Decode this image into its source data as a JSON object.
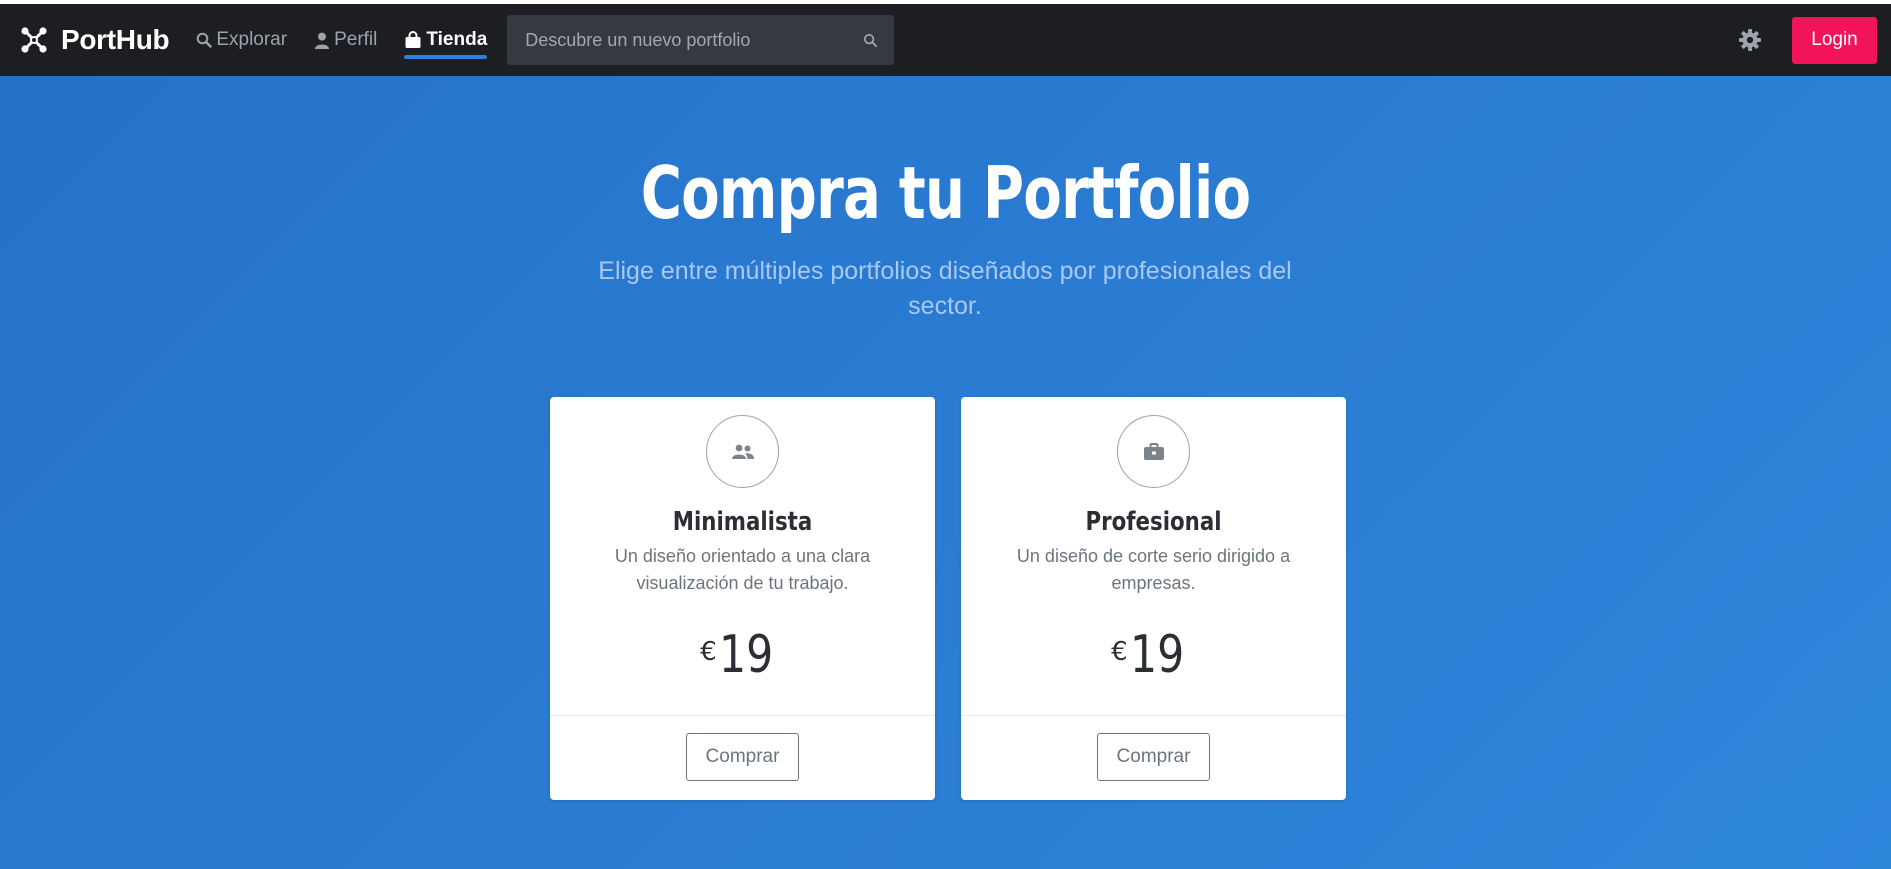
{
  "colors": {
    "nav_bg": "#1c1e22",
    "accent_underline": "#2e7de0",
    "login_bg": "#f1145a",
    "hero_bg": "#2a7dd3",
    "card_bg": "#ffffff"
  },
  "navbar": {
    "brand": {
      "name": "PortHub",
      "icon": "porthub-logo-icon"
    },
    "links": [
      {
        "label": "Explorar",
        "icon": "search-icon",
        "active": false
      },
      {
        "label": "Perfil",
        "icon": "user-icon",
        "active": false
      },
      {
        "label": "Tienda",
        "icon": "shopping-bag-icon",
        "active": true
      }
    ],
    "search": {
      "placeholder": "Descubre un nuevo portfolio",
      "value": "",
      "icon": "search-icon"
    },
    "settings_icon": "gear-icon",
    "login_label": "Login"
  },
  "hero": {
    "title": "Compra tu Portfolio",
    "subtitle": "Elige entre múltiples portfolios diseñados por profesionales del sector."
  },
  "plans": [
    {
      "icon": "users-icon",
      "name": "Minimalista",
      "description": "Un diseño orientado a una clara visualización de tu trabajo.",
      "currency": "€",
      "price": "19",
      "button_label": "Comprar"
    },
    {
      "icon": "briefcase-icon",
      "name": "Profesional",
      "description": "Un diseño de corte serio dirigido a empresas.",
      "currency": "€",
      "price": "19",
      "button_label": "Comprar"
    }
  ]
}
